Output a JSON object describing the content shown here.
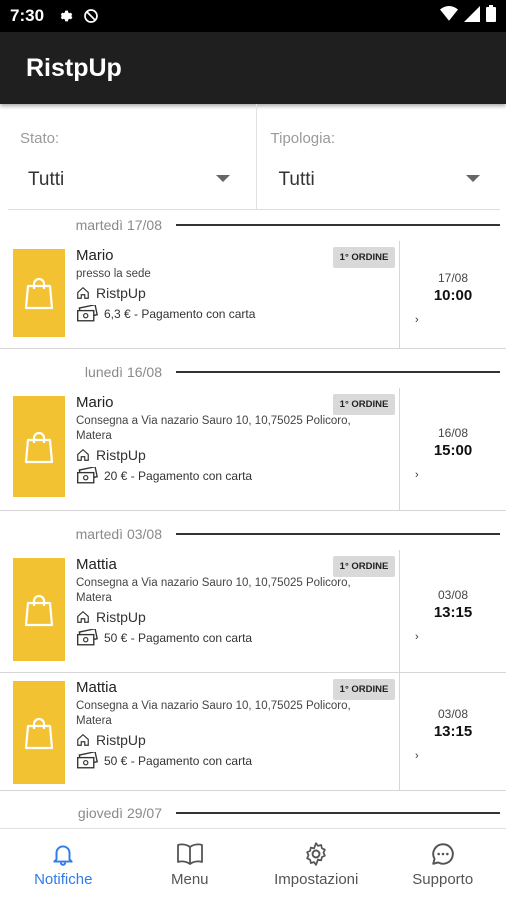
{
  "status": {
    "time": "7:30"
  },
  "app": {
    "title": "RistpUp"
  },
  "filters": [
    {
      "label": "Stato:",
      "value": "Tutti"
    },
    {
      "label": "Tipologia:",
      "value": "Tutti"
    }
  ],
  "dates": [
    "martedì 17/08",
    "lunedì 16/08",
    "martedì 03/08",
    "giovedì 29/07"
  ],
  "orders": [
    {
      "name": "Mario",
      "address": "presso la sede",
      "shop": "RistpUp",
      "payment": "6,3 € - Pagamento con carta",
      "badge": "1° ORDINE",
      "date": "17/08",
      "time": "10:00",
      "chevron": "›"
    },
    {
      "name": "Mario",
      "address": "Consegna a Via nazario Sauro 10, 10,75025 Policoro, Matera",
      "shop": "RistpUp",
      "payment": "20 € - Pagamento con carta",
      "badge": "1° ORDINE",
      "date": "16/08",
      "time": "15:00",
      "chevron": "›"
    },
    {
      "name": "Mattia",
      "address": "Consegna a Via nazario Sauro 10, 10,75025 Policoro, Matera",
      "shop": "RistpUp",
      "payment": "50 € - Pagamento con carta",
      "badge": "1° ORDINE",
      "date": "03/08",
      "time": "13:15",
      "chevron": "›"
    },
    {
      "name": "Mattia",
      "address": "Consegna a Via nazario Sauro 10, 10,75025 Policoro, Matera",
      "shop": "RistpUp",
      "payment": "50 € - Pagamento con carta",
      "badge": "1° ORDINE",
      "date": "03/08",
      "time": "13:15",
      "chevron": "›"
    }
  ],
  "nav": [
    {
      "label": "Notifiche",
      "icon": "bell-icon",
      "active": true
    },
    {
      "label": "Menu",
      "icon": "book-icon",
      "active": false
    },
    {
      "label": "Impostazioni",
      "icon": "gear-icon",
      "active": false
    },
    {
      "label": "Supporto",
      "icon": "chat-icon",
      "active": false
    }
  ],
  "colors": {
    "accent": "#2f7be8",
    "bag": "#f2c232",
    "appbar": "#1f1f1f"
  }
}
